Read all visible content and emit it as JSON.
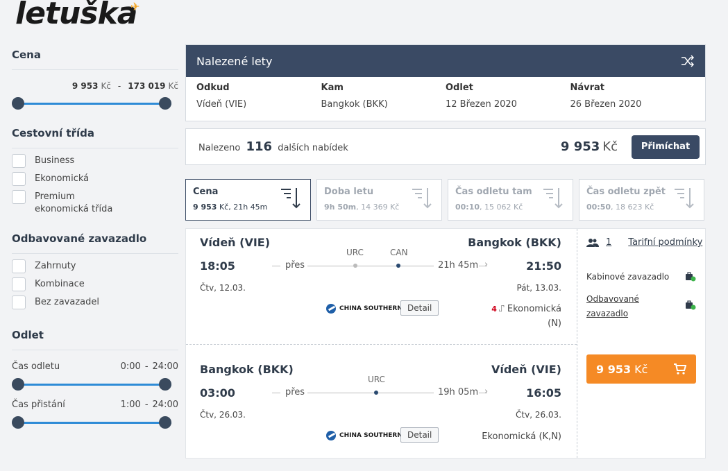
{
  "logo": {
    "text": "letuška"
  },
  "sidebar": {
    "price": {
      "heading": "Cena",
      "min": "9 953",
      "max": "173 019",
      "unit": "Kč",
      "dash": "-"
    },
    "class": {
      "heading": "Cestovní třída",
      "options": [
        "Business",
        "Ekonomická",
        "Premium ekonomická třída"
      ]
    },
    "baggage": {
      "heading": "Odbavované zavazadlo",
      "options": [
        "Zahrnuty",
        "Kombinace",
        "Bez zavazadel"
      ]
    },
    "departure": {
      "heading": "Odlet",
      "dep_label": "Čas odletu",
      "dep_from": "0:00",
      "dep_to": "24:00",
      "arr_label": "Čas přistání",
      "arr_from": "1:00",
      "arr_to": "24:00",
      "dash": "-"
    }
  },
  "panel": {
    "title": "Nalezené lety",
    "from_label": "Odkud",
    "from": "Vídeň (VIE)",
    "to_label": "Kam",
    "to": "Bangkok (BKK)",
    "dep_label": "Odlet",
    "dep": "12 Březen 2020",
    "ret_label": "Návrat",
    "ret": "26 Březen 2020"
  },
  "found": {
    "prefix": "Nalezeno",
    "count": "116",
    "suffix": "dalších nabídek",
    "price": "9 953",
    "unit": "Kč",
    "button": "Přimíchat"
  },
  "sorts": [
    {
      "title": "Cena",
      "bold": "9 953",
      "rest": " Kč, 21h 45m"
    },
    {
      "title": "Doba letu",
      "bold": "9h 50m",
      "rest": ", 14 369  Kč"
    },
    {
      "title": "Čas odletu tam",
      "bold": "00:10",
      "rest": ", 15 062  Kč"
    },
    {
      "title": "Čas odletu zpět",
      "bold": "00:50",
      "rest": ", 18 623  Kč"
    }
  ],
  "result": {
    "out": {
      "from": "Vídeň (VIE)",
      "to": "Bangkok (BKK)",
      "dep_time": "18:05",
      "arr_time": "21:50",
      "dep_date": "Čtv, 12.03.",
      "arr_date": "Pát, 13.03.",
      "via": "přes",
      "stops": [
        "URC",
        "CAN"
      ],
      "duration": "21h 45m",
      "airline": "CHINA SOUTHERN",
      "detail": "Detail",
      "seats": "4",
      "cabin": "Ekonomická",
      "cabin_code": "(N)"
    },
    "ret": {
      "from": "Bangkok (BKK)",
      "to": "Vídeň (VIE)",
      "dep_time": "03:00",
      "arr_time": "16:05",
      "dep_date": "Čtv, 26.03.",
      "arr_date": "Čtv, 26.03.",
      "via": "přes",
      "stops": [
        "URC"
      ],
      "duration": "19h 05m",
      "airline": "CHINA SOUTHERN",
      "detail": "Detail",
      "cabin": "Ekonomická (K,N)"
    },
    "passengers": "1",
    "tariff": "Tarifní podmínky",
    "cabin_bag": "Kabinové zavazadlo",
    "checked_bag_1": "Odbavované",
    "checked_bag_2": "zavazadlo",
    "price": "9 953",
    "unit": "Kč"
  }
}
